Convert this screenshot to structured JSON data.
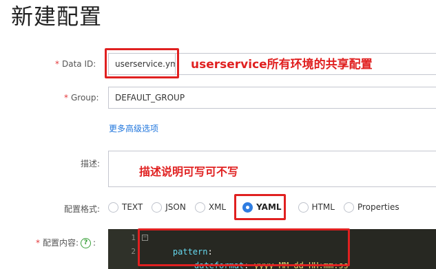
{
  "page": {
    "title": "新建配置"
  },
  "form": {
    "data_id": {
      "required_mark": "*",
      "label": "Data ID:",
      "value": "userservice.yml"
    },
    "group": {
      "required_mark": "*",
      "label": "Group:",
      "value": "DEFAULT_GROUP"
    },
    "advanced_link": "更多高级选项",
    "description": {
      "label": "描述:",
      "value": ""
    },
    "format": {
      "label": "配置格式:",
      "options": [
        "TEXT",
        "JSON",
        "XML",
        "YAML",
        "HTML",
        "Properties"
      ],
      "selected": "YAML"
    },
    "content": {
      "required_mark": "*",
      "label": "配置内容:",
      "help_icon": "question-circle-icon",
      "help_glyph": "?",
      "colon": ":",
      "lines": [
        {
          "number": "1",
          "fold": "−",
          "key": "pattern",
          "punct": ":",
          "value": ""
        },
        {
          "number": "2",
          "fold": "",
          "key": "dateformat",
          "punct": ": ",
          "value": "yyyy-MM-dd HH:mm:ss"
        }
      ]
    }
  },
  "annotations": {
    "data_id_note": "userservice所有环境的共享配置",
    "description_note": "描述说明可写可不写"
  },
  "colors": {
    "annotation_red": "#e02020",
    "link_blue": "#2277dd",
    "radio_blue": "#2f7de1",
    "editor_bg": "#272822"
  }
}
